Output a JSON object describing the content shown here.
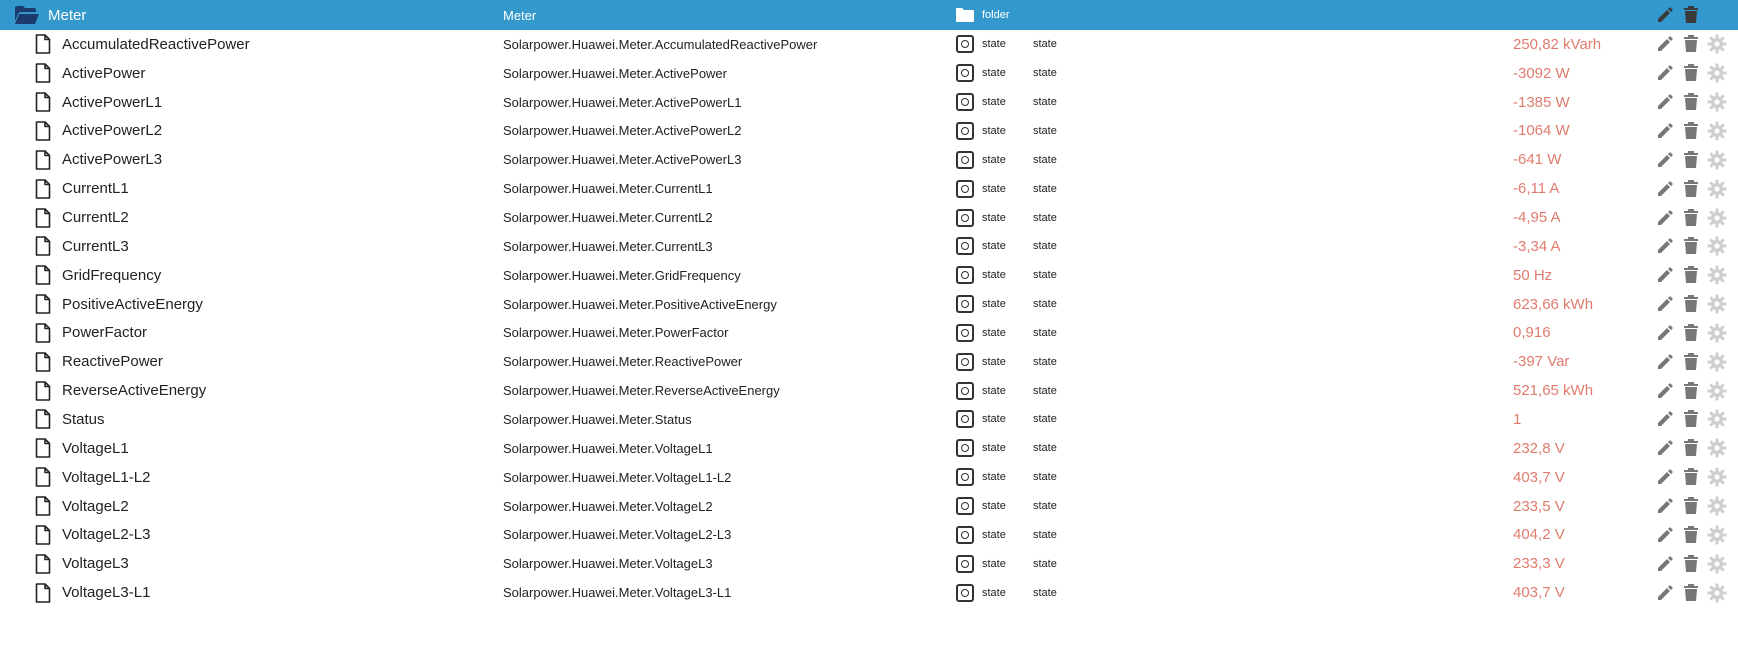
{
  "header": {
    "name": "Meter",
    "id": "Meter",
    "type": "folder"
  },
  "rows": [
    {
      "name": "AccumulatedReactivePower",
      "id": "Solarpower.Huawei.Meter.AccumulatedReactivePower",
      "type": "state",
      "role": "state",
      "value": "250,82 kVarh"
    },
    {
      "name": "ActivePower",
      "id": "Solarpower.Huawei.Meter.ActivePower",
      "type": "state",
      "role": "state",
      "value": "-3092 W"
    },
    {
      "name": "ActivePowerL1",
      "id": "Solarpower.Huawei.Meter.ActivePowerL1",
      "type": "state",
      "role": "state",
      "value": "-1385 W"
    },
    {
      "name": "ActivePowerL2",
      "id": "Solarpower.Huawei.Meter.ActivePowerL2",
      "type": "state",
      "role": "state",
      "value": "-1064 W"
    },
    {
      "name": "ActivePowerL3",
      "id": "Solarpower.Huawei.Meter.ActivePowerL3",
      "type": "state",
      "role": "state",
      "value": "-641 W"
    },
    {
      "name": "CurrentL1",
      "id": "Solarpower.Huawei.Meter.CurrentL1",
      "type": "state",
      "role": "state",
      "value": "-6,11 A"
    },
    {
      "name": "CurrentL2",
      "id": "Solarpower.Huawei.Meter.CurrentL2",
      "type": "state",
      "role": "state",
      "value": "-4,95 A"
    },
    {
      "name": "CurrentL3",
      "id": "Solarpower.Huawei.Meter.CurrentL3",
      "type": "state",
      "role": "state",
      "value": "-3,34 A"
    },
    {
      "name": "GridFrequency",
      "id": "Solarpower.Huawei.Meter.GridFrequency",
      "type": "state",
      "role": "state",
      "value": "50 Hz"
    },
    {
      "name": "PositiveActiveEnergy",
      "id": "Solarpower.Huawei.Meter.PositiveActiveEnergy",
      "type": "state",
      "role": "state",
      "value": "623,66 kWh"
    },
    {
      "name": "PowerFactor",
      "id": "Solarpower.Huawei.Meter.PowerFactor",
      "type": "state",
      "role": "state",
      "value": "0,916"
    },
    {
      "name": "ReactivePower",
      "id": "Solarpower.Huawei.Meter.ReactivePower",
      "type": "state",
      "role": "state",
      "value": "-397 Var"
    },
    {
      "name": "ReverseActiveEnergy",
      "id": "Solarpower.Huawei.Meter.ReverseActiveEnergy",
      "type": "state",
      "role": "state",
      "value": "521,65 kWh"
    },
    {
      "name": "Status",
      "id": "Solarpower.Huawei.Meter.Status",
      "type": "state",
      "role": "state",
      "value": "1"
    },
    {
      "name": "VoltageL1",
      "id": "Solarpower.Huawei.Meter.VoltageL1",
      "type": "state",
      "role": "state",
      "value": "232,8 V"
    },
    {
      "name": "VoltageL1-L2",
      "id": "Solarpower.Huawei.Meter.VoltageL1-L2",
      "type": "state",
      "role": "state",
      "value": "403,7 V"
    },
    {
      "name": "VoltageL2",
      "id": "Solarpower.Huawei.Meter.VoltageL2",
      "type": "state",
      "role": "state",
      "value": "233,5 V"
    },
    {
      "name": "VoltageL2-L3",
      "id": "Solarpower.Huawei.Meter.VoltageL2-L3",
      "type": "state",
      "role": "state",
      "value": "404,2 V"
    },
    {
      "name": "VoltageL3",
      "id": "Solarpower.Huawei.Meter.VoltageL3",
      "type": "state",
      "role": "state",
      "value": "233,3 V"
    },
    {
      "name": "VoltageL3-L1",
      "id": "Solarpower.Huawei.Meter.VoltageL3-L1",
      "type": "state",
      "role": "state",
      "value": "403,7 V"
    }
  ],
  "icons": {
    "header_folder": "folder-open-icon",
    "type_folder": "folder-icon",
    "row_file": "file-icon",
    "row_state": "state-icon",
    "edit": "pencil-icon",
    "delete": "trash-icon",
    "settings": "gear-icon"
  },
  "colors": {
    "header_bg": "#3399cc",
    "value_text": "#e07b6d",
    "action_icon": "#777777",
    "settings_icon": "#cfcfcf"
  }
}
